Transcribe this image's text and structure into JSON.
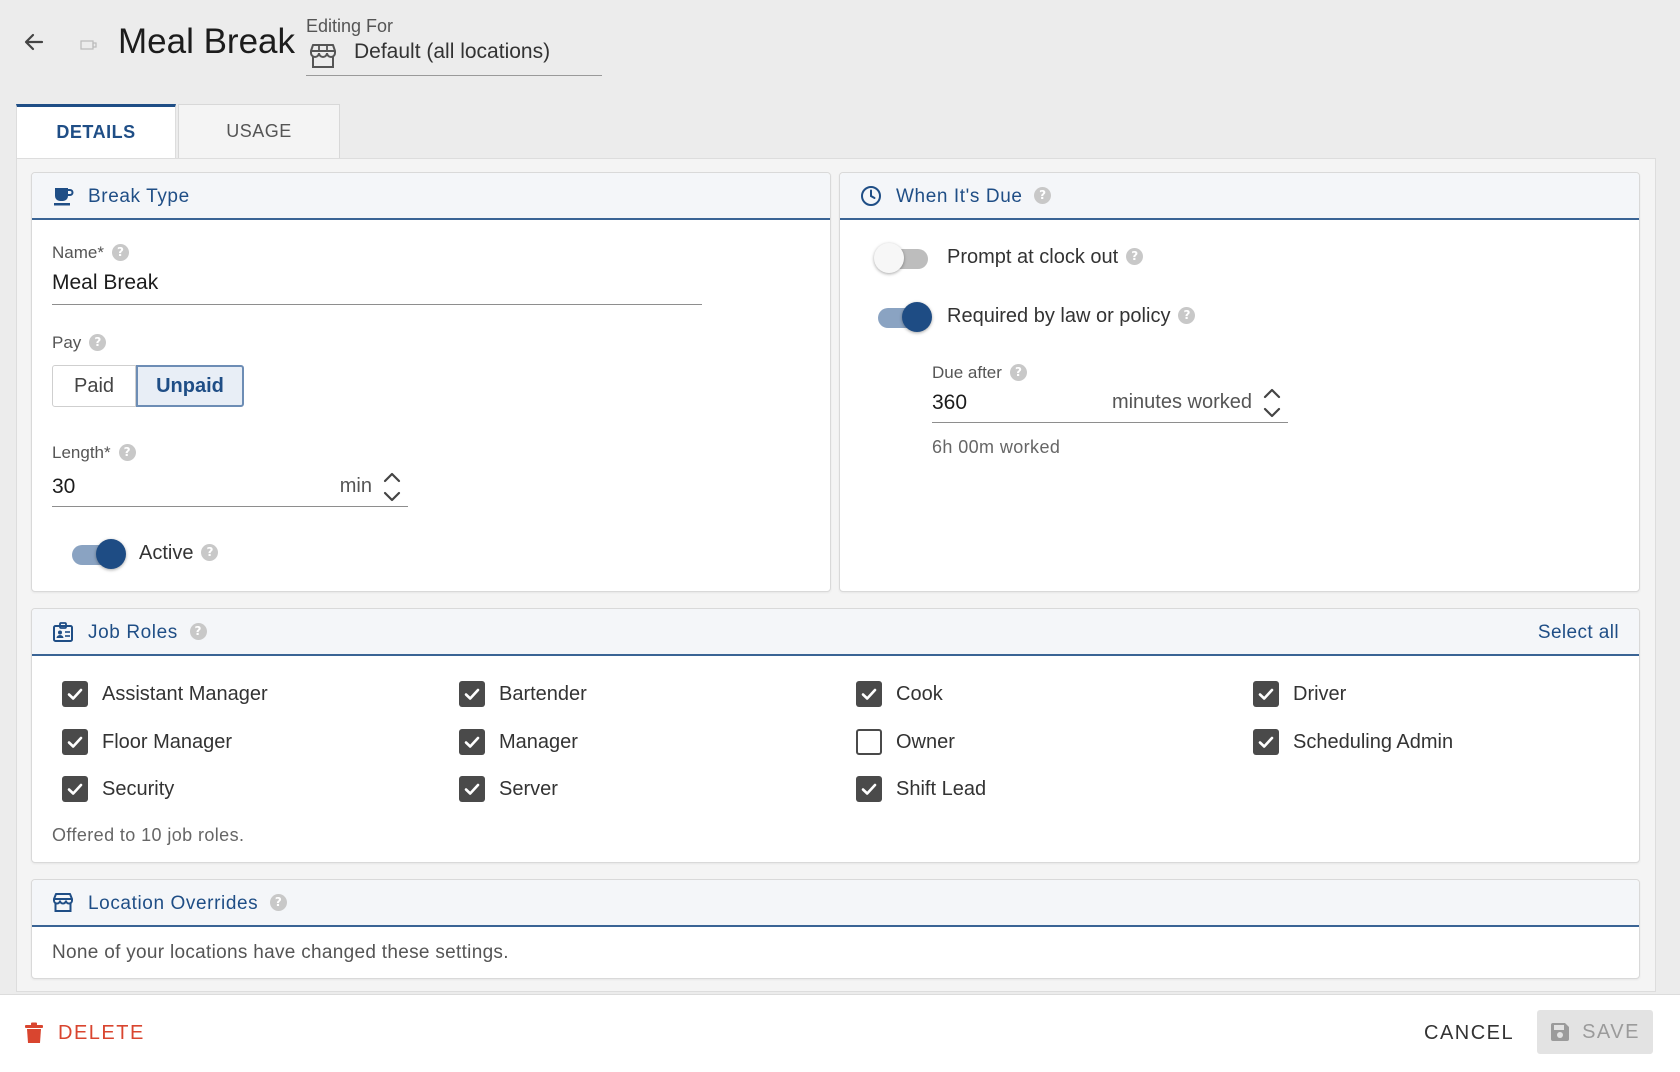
{
  "header": {
    "title": "Meal Break",
    "editing_for_label": "Editing For",
    "editing_for_value": "Default (all locations)"
  },
  "tabs": [
    {
      "label": "DETAILS",
      "active": true
    },
    {
      "label": "USAGE",
      "active": false
    }
  ],
  "break_type": {
    "title": "Break Type",
    "name_label": "Name*",
    "name_value": "Meal Break",
    "pay_label": "Pay",
    "pay_options": [
      "Paid",
      "Unpaid"
    ],
    "pay_selected": "Unpaid",
    "length_label": "Length*",
    "length_value": "30",
    "length_unit": "min",
    "active_label": "Active",
    "active_on": true
  },
  "when_due": {
    "title": "When It's Due",
    "prompt_label": "Prompt at clock out",
    "prompt_on": false,
    "required_label": "Required by law or policy",
    "required_on": true,
    "due_after_label": "Due after",
    "due_after_value": "360",
    "due_after_unit": "minutes worked",
    "due_after_hint": "6h 00m worked"
  },
  "job_roles": {
    "title": "Job Roles",
    "select_all": "Select all",
    "roles": [
      {
        "label": "Assistant Manager",
        "checked": true
      },
      {
        "label": "Bartender",
        "checked": true
      },
      {
        "label": "Cook",
        "checked": true
      },
      {
        "label": "Driver",
        "checked": true
      },
      {
        "label": "Floor Manager",
        "checked": true
      },
      {
        "label": "Manager",
        "checked": true
      },
      {
        "label": "Owner",
        "checked": false
      },
      {
        "label": "Scheduling Admin",
        "checked": true
      },
      {
        "label": "Security",
        "checked": true
      },
      {
        "label": "Server",
        "checked": true
      },
      {
        "label": "Shift Lead",
        "checked": true
      }
    ],
    "summary": "Offered to 10 job roles."
  },
  "location_overrides": {
    "title": "Location Overrides",
    "message": "None of your locations have changed these settings."
  },
  "footer": {
    "delete_label": "DELETE",
    "cancel_label": "CANCEL",
    "save_label": "SAVE"
  },
  "colors": {
    "accent": "#1f4e86",
    "danger": "#d9452f",
    "checkbox": "#4a4a4a"
  }
}
